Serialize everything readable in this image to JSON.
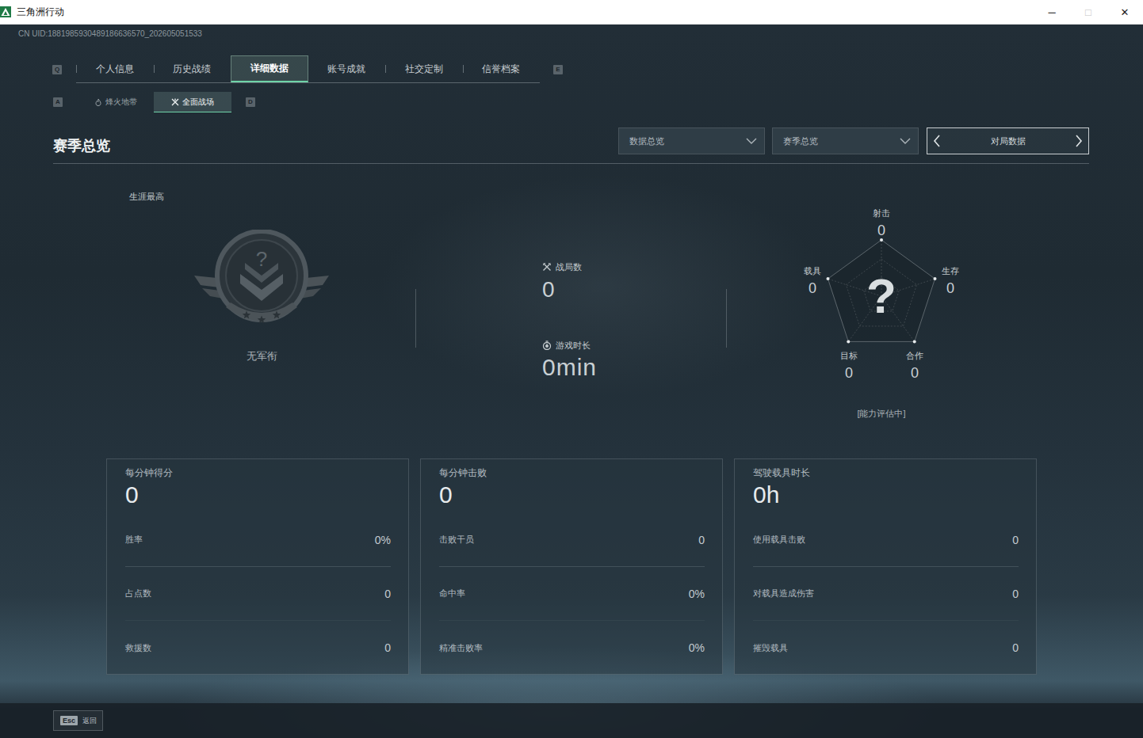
{
  "window": {
    "title": "三角洲行动",
    "controls": [
      {
        "glyph": "─",
        "disabled": false
      },
      {
        "glyph": "□",
        "disabled": true
      },
      {
        "glyph": "✕",
        "disabled": false
      }
    ]
  },
  "uid": "CN UID:1881985930489186636570_202605051533",
  "tabs": {
    "prev_key": "Q",
    "next_key": "E",
    "items": [
      {
        "label": "个人信息",
        "selected": false
      },
      {
        "label": "历史战绩",
        "selected": false
      },
      {
        "label": "详细数据",
        "selected": true
      },
      {
        "label": "账号成就",
        "selected": false
      },
      {
        "label": "社交定制",
        "selected": false
      },
      {
        "label": "信誉档案",
        "selected": false
      }
    ]
  },
  "mode_tabs": {
    "prev_key": "A",
    "next_key": "D",
    "items": [
      {
        "label": "烽火地带",
        "selected": false
      },
      {
        "label": "全面战场",
        "selected": true
      }
    ]
  },
  "section": {
    "title": "赛季总览",
    "dropdowns": [
      "数据总览",
      "赛季总览"
    ],
    "stepper": "对局数据"
  },
  "rank": {
    "label": "生涯最高",
    "badge": "?",
    "name": "无军衔"
  },
  "summary": [
    {
      "label": "战局数",
      "value": "0"
    },
    {
      "label": "游戏时长",
      "value": "0min"
    }
  ],
  "radar": {
    "center": "?",
    "status": "[能力评估中]",
    "axes": [
      {
        "label": "射击",
        "value": "0",
        "level": 0
      },
      {
        "label": "生存",
        "value": "0",
        "level": 0
      },
      {
        "label": "合作",
        "value": "0",
        "level": 0
      },
      {
        "label": "目标",
        "value": "0",
        "level": 0
      },
      {
        "label": "载具",
        "value": "0",
        "level": 0
      }
    ]
  },
  "cards": [
    {
      "label": "每分钟得分",
      "value": "0",
      "rows": [
        {
          "label": "胜率",
          "value": "0%"
        },
        {
          "label": "占点数",
          "value": "0"
        },
        {
          "label": "救援数",
          "value": "0"
        }
      ]
    },
    {
      "label": "每分钟击败",
      "value": "0",
      "rows": [
        {
          "label": "击败干员",
          "value": "0"
        },
        {
          "label": "命中率",
          "value": "0%"
        },
        {
          "label": "精准击败率",
          "value": "0%"
        }
      ]
    },
    {
      "label": "驾驶载具时长",
      "value": "0h",
      "rows": [
        {
          "label": "使用载具击败",
          "value": "0"
        },
        {
          "label": "对载具造成伤害",
          "value": "0"
        },
        {
          "label": "摧毁载具",
          "value": "0"
        }
      ]
    }
  ],
  "footer": {
    "key": "Esc",
    "label": "返回"
  }
}
